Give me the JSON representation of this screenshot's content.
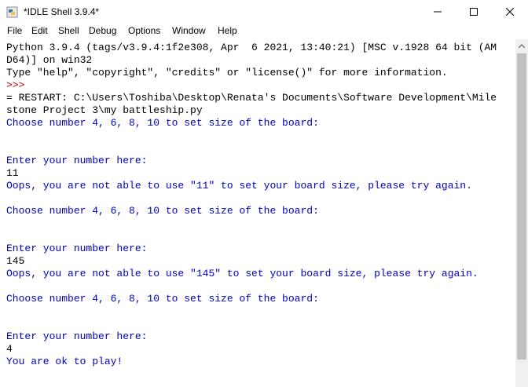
{
  "window": {
    "title": "*IDLE Shell 3.9.4*"
  },
  "menu": [
    "File",
    "Edit",
    "Shell",
    "Debug",
    "Options",
    "Window",
    "Help"
  ],
  "colors": {
    "output": "#000000",
    "prompt": "#c00000",
    "program_output": "#0000c0"
  },
  "lines": [
    {
      "text": "Python 3.9.4 (tags/v3.9.4:1f2e308, Apr  6 2021, 13:40:21) [MSC v.1928 64 bit (AM",
      "kind": "output"
    },
    {
      "text": "D64)] on win32",
      "kind": "output"
    },
    {
      "text": "Type \"help\", \"copyright\", \"credits\" or \"license()\" for more information.",
      "kind": "output"
    },
    {
      "text": ">>>",
      "kind": "prompt"
    },
    {
      "text": "= RESTART: C:\\Users\\Toshiba\\Desktop\\Renata's Documents\\Software Development\\Mile",
      "kind": "output"
    },
    {
      "text": "stone Project 3\\my battleship.py",
      "kind": "output"
    },
    {
      "text": "Choose number 4, 6, 8, 10 to set size of the board:",
      "kind": "program_output"
    },
    {
      "text": "",
      "kind": "program_output"
    },
    {
      "text": "",
      "kind": "program_output"
    },
    {
      "text": "Enter your number here:",
      "kind": "program_output"
    },
    {
      "text": "11",
      "kind": "output"
    },
    {
      "text": "Oops, you are not able to use \"11\" to set your board size, please try again.",
      "kind": "program_output"
    },
    {
      "text": "",
      "kind": "program_output"
    },
    {
      "text": "Choose number 4, 6, 8, 10 to set size of the board:",
      "kind": "program_output"
    },
    {
      "text": "",
      "kind": "program_output"
    },
    {
      "text": "",
      "kind": "program_output"
    },
    {
      "text": "Enter your number here:",
      "kind": "program_output"
    },
    {
      "text": "145",
      "kind": "output"
    },
    {
      "text": "Oops, you are not able to use \"145\" to set your board size, please try again.",
      "kind": "program_output"
    },
    {
      "text": "",
      "kind": "program_output"
    },
    {
      "text": "Choose number 4, 6, 8, 10 to set size of the board:",
      "kind": "program_output"
    },
    {
      "text": "",
      "kind": "program_output"
    },
    {
      "text": "",
      "kind": "program_output"
    },
    {
      "text": "Enter your number here:",
      "kind": "program_output"
    },
    {
      "text": "4",
      "kind": "output"
    },
    {
      "text": "You are ok to play!",
      "kind": "program_output"
    }
  ]
}
